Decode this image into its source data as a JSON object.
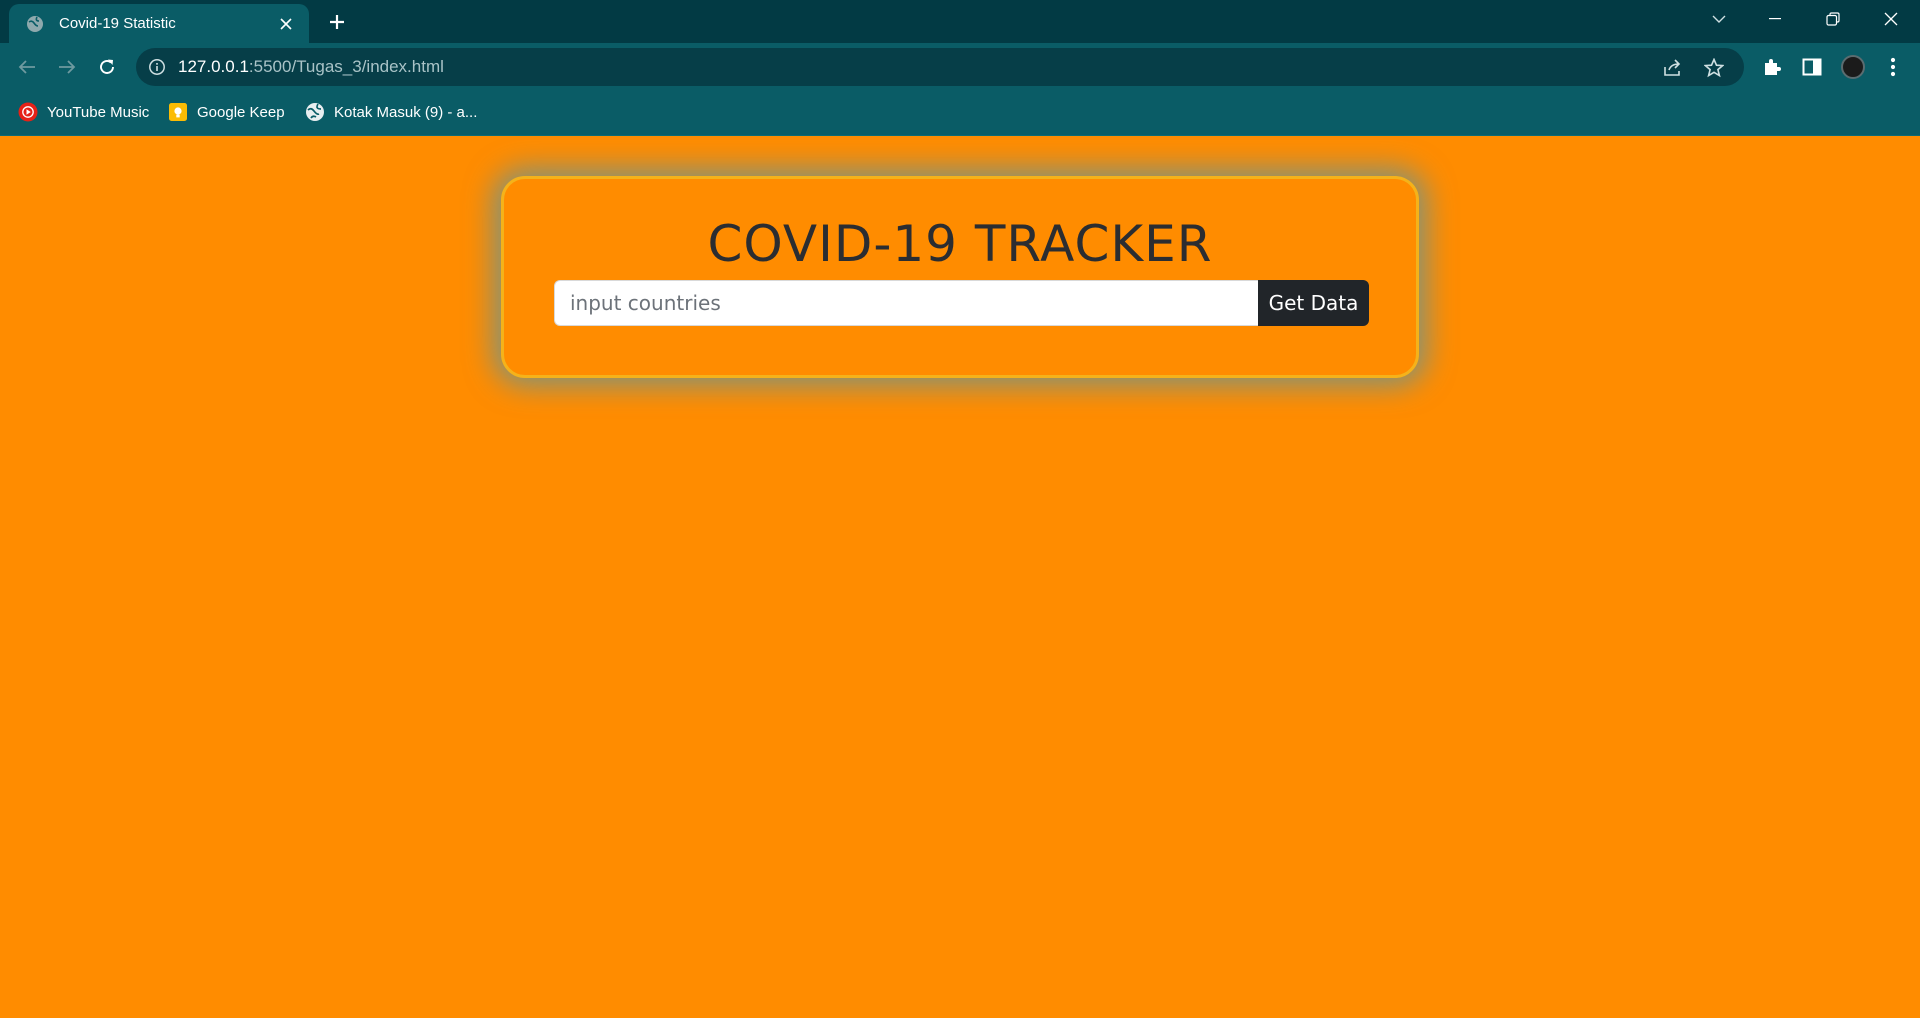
{
  "browser": {
    "tab": {
      "title": "Covid-19 Statistic"
    },
    "address": {
      "host": "127.0.0.1",
      "rest": ":5500/Tugas_3/index.html"
    },
    "bookmarks": [
      {
        "label": "YouTube Music",
        "icon": "youtube-music-icon"
      },
      {
        "label": "Google Keep",
        "icon": "google-keep-icon"
      },
      {
        "label": "Kotak Masuk (9) - a...",
        "icon": "globe-icon"
      }
    ]
  },
  "page": {
    "title": "COVID-19 TRACKER",
    "search": {
      "placeholder": "input countries",
      "value": ""
    },
    "button_label": "Get Data"
  },
  "colors": {
    "page_background": "#ff8c00",
    "browser_frame": "#023a44",
    "toolbar": "#0a5c66",
    "button": "#212529"
  }
}
